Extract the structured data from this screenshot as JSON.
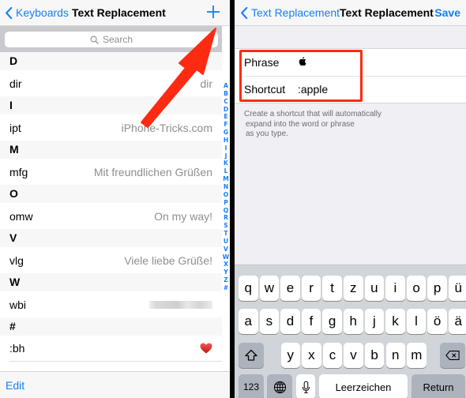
{
  "left": {
    "nav": {
      "back_label": "Keyboards",
      "title": "Text Replacement",
      "add_icon": "plus-icon"
    },
    "search": {
      "placeholder": "Search",
      "icon": "search-icon"
    },
    "sections": [
      {
        "header": "D",
        "items": [
          {
            "shortcut": "dir",
            "phrase": "dir"
          }
        ]
      },
      {
        "header": "I",
        "items": [
          {
            "shortcut": "ipt",
            "phrase": "iPhone-Tricks.com"
          }
        ]
      },
      {
        "header": "M",
        "items": [
          {
            "shortcut": "mfg",
            "phrase": "Mit freundlichen Grüßen"
          }
        ]
      },
      {
        "header": "O",
        "items": [
          {
            "shortcut": "omw",
            "phrase": "On my way!"
          }
        ]
      },
      {
        "header": "V",
        "items": [
          {
            "shortcut": "vlg",
            "phrase": "Viele liebe Grüße!"
          }
        ]
      },
      {
        "header": "W",
        "items": [
          {
            "shortcut": "wbi",
            "phrase": "[blurred]"
          }
        ]
      },
      {
        "header": "#",
        "items": [
          {
            "shortcut": ":bh",
            "phrase": "heart-emoji"
          }
        ]
      }
    ],
    "index": [
      "A",
      "B",
      "C",
      "D",
      "E",
      "F",
      "G",
      "H",
      "I",
      "J",
      "K",
      "L",
      "M",
      "N",
      "O",
      "P",
      "Q",
      "R",
      "S",
      "T",
      "U",
      "V",
      "W",
      "X",
      "Y",
      "Z",
      "#"
    ],
    "toolbar": {
      "edit_label": "Edit"
    },
    "annotation": {
      "type": "arrow",
      "color": "#ff2a12",
      "points_to": "add-button"
    }
  },
  "right": {
    "nav": {
      "back_label": "Text Replacement",
      "title": "Text Replacement",
      "save_label": "Save"
    },
    "form": {
      "phrase_label": "Phrase",
      "phrase_value": "apple-logo",
      "shortcut_label": "Shortcut",
      "shortcut_value": ":apple"
    },
    "footer_lines": [
      "Create a shortcut that will automatically",
      "expand into the word or phrase",
      "as you type."
    ],
    "highlight_color": "#ff2a12"
  },
  "keyboard": {
    "row1": [
      "q",
      "w",
      "e",
      "r",
      "t",
      "z",
      "u",
      "i",
      "o",
      "p",
      "ü"
    ],
    "row2": [
      "a",
      "s",
      "d",
      "f",
      "g",
      "h",
      "j",
      "k",
      "l",
      "ö",
      "ä"
    ],
    "row3": [
      "y",
      "x",
      "c",
      "v",
      "b",
      "n",
      "m"
    ],
    "shift_icon": "shift-icon",
    "delete_icon": "backspace-icon",
    "numbers_label": "123",
    "globe_icon": "globe-icon",
    "mic_icon": "microphone-icon",
    "space_label": "Leerzeichen",
    "return_label": "Return"
  },
  "colors": {
    "accent": "#147efb",
    "annotation": "#ff2a12",
    "secondary_text": "#8e8e93",
    "grouped_bg": "#efeff4",
    "keyboard_bg": "#d1d4d9"
  }
}
